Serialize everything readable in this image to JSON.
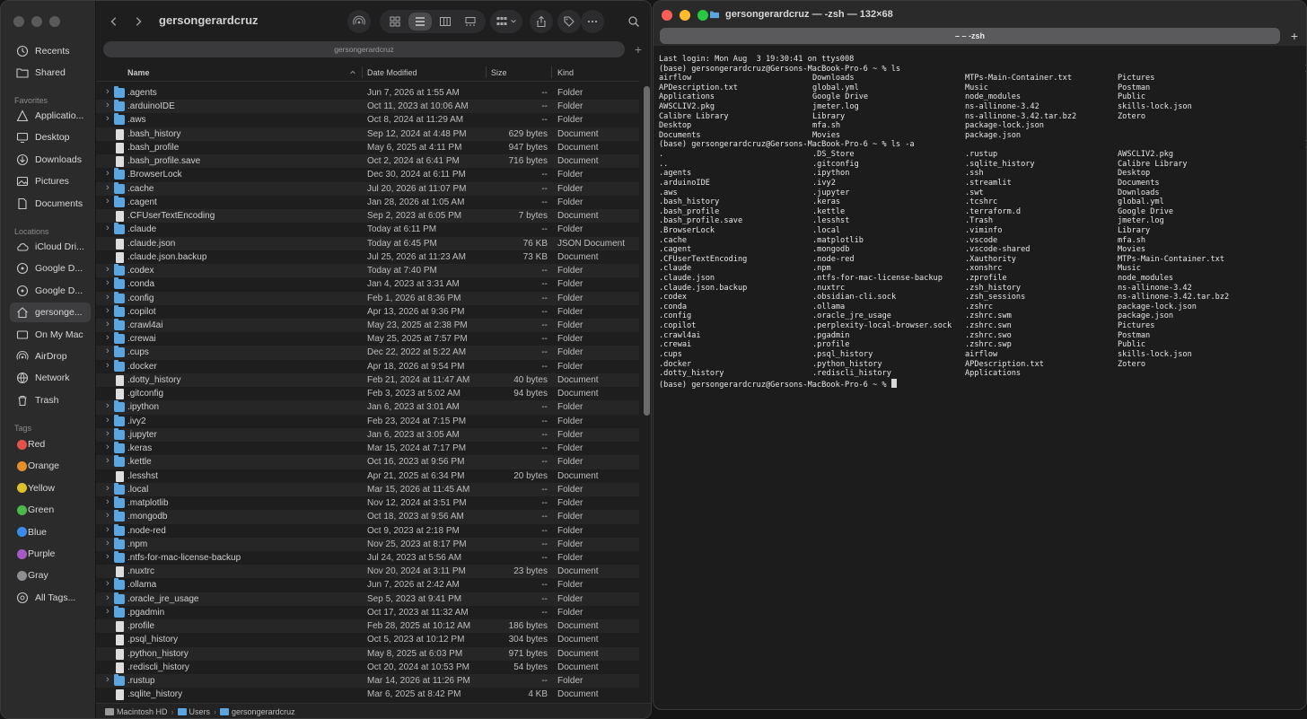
{
  "finder": {
    "title": "gersongerardcruz",
    "path_title": "gersongerardcruz",
    "sidebar": {
      "favorites_label": "Favorites",
      "locations_label": "Locations",
      "tags_label": "Tags",
      "top_items": [
        {
          "label": "Recents",
          "icon": "clock-icon"
        },
        {
          "label": "Shared",
          "icon": "shared-folder-icon"
        }
      ],
      "favorites": [
        {
          "label": "Applicatio...",
          "icon": "applications-icon"
        },
        {
          "label": "Desktop",
          "icon": "desktop-icon"
        },
        {
          "label": "Downloads",
          "icon": "downloads-icon"
        },
        {
          "label": "Pictures",
          "icon": "pictures-icon"
        },
        {
          "label": "Documents",
          "icon": "document-icon"
        }
      ],
      "locations": [
        {
          "label": "iCloud Dri...",
          "icon": "cloud-icon"
        },
        {
          "label": "Google D...",
          "icon": "drive-icon"
        },
        {
          "label": "Google D...",
          "icon": "drive-icon"
        },
        {
          "label": "gersonge...",
          "icon": "home-icon"
        },
        {
          "label": "On My Mac",
          "icon": "folder-icon"
        },
        {
          "label": "AirDrop",
          "icon": "airdrop-icon"
        },
        {
          "label": "Network",
          "icon": "network-icon"
        },
        {
          "label": "Trash",
          "icon": "trash-icon"
        }
      ],
      "tags": [
        {
          "label": "Red",
          "color": "#e0524a"
        },
        {
          "label": "Orange",
          "color": "#e58e2a"
        },
        {
          "label": "Yellow",
          "color": "#dcc12a"
        },
        {
          "label": "Green",
          "color": "#4cb84a"
        },
        {
          "label": "Blue",
          "color": "#3a8bea"
        },
        {
          "label": "Purple",
          "color": "#a65ac4"
        },
        {
          "label": "Gray",
          "color": "#8e8e92"
        },
        {
          "label": "All Tags...",
          "color": ""
        }
      ]
    },
    "columns": {
      "name": "Name",
      "date": "Date Modified",
      "size": "Size",
      "kind": "Kind"
    },
    "rows": [
      {
        "name": ".agents",
        "date": "Jun 7, 2026 at 1:55 AM",
        "size": "--",
        "kind": "Folder",
        "folder": true
      },
      {
        "name": ".arduinoIDE",
        "date": "Oct 11, 2023 at 10:06 AM",
        "size": "--",
        "kind": "Folder",
        "folder": true
      },
      {
        "name": ".aws",
        "date": "Oct 8, 2024 at 11:29 AM",
        "size": "--",
        "kind": "Folder",
        "folder": true
      },
      {
        "name": ".bash_history",
        "date": "Sep 12, 2024 at 4:48 PM",
        "size": "629 bytes",
        "kind": "Document",
        "folder": false
      },
      {
        "name": ".bash_profile",
        "date": "May 6, 2025 at 4:11 PM",
        "size": "947 bytes",
        "kind": "Document",
        "folder": false
      },
      {
        "name": ".bash_profile.save",
        "date": "Oct 2, 2024 at 6:41 PM",
        "size": "716 bytes",
        "kind": "Document",
        "folder": false
      },
      {
        "name": ".BrowserLock",
        "date": "Dec 30, 2024 at 6:11 PM",
        "size": "--",
        "kind": "Folder",
        "folder": true
      },
      {
        "name": ".cache",
        "date": "Jul 20, 2026 at 11:07 PM",
        "size": "--",
        "kind": "Folder",
        "folder": true
      },
      {
        "name": ".cagent",
        "date": "Jan 28, 2026 at 1:05 AM",
        "size": "--",
        "kind": "Folder",
        "folder": true
      },
      {
        "name": ".CFUserTextEncoding",
        "date": "Sep 2, 2023 at 6:05 PM",
        "size": "7 bytes",
        "kind": "Document",
        "folder": false
      },
      {
        "name": ".claude",
        "date": "Today at 6:11 PM",
        "size": "--",
        "kind": "Folder",
        "folder": true
      },
      {
        "name": ".claude.json",
        "date": "Today at 6:45 PM",
        "size": "76 KB",
        "kind": "JSON Document",
        "folder": false
      },
      {
        "name": ".claude.json.backup",
        "date": "Jul 25, 2026 at 11:23 AM",
        "size": "73 KB",
        "kind": "Document",
        "folder": false
      },
      {
        "name": ".codex",
        "date": "Today at 7:40 PM",
        "size": "--",
        "kind": "Folder",
        "folder": true
      },
      {
        "name": ".conda",
        "date": "Jan 4, 2023 at 3:31 AM",
        "size": "--",
        "kind": "Folder",
        "folder": true
      },
      {
        "name": ".config",
        "date": "Feb 1, 2026 at 8:36 PM",
        "size": "--",
        "kind": "Folder",
        "folder": true
      },
      {
        "name": ".copilot",
        "date": "Apr 13, 2026 at 9:36 PM",
        "size": "--",
        "kind": "Folder",
        "folder": true
      },
      {
        "name": ".crawl4ai",
        "date": "May 23, 2025 at 2:38 PM",
        "size": "--",
        "kind": "Folder",
        "folder": true
      },
      {
        "name": ".crewai",
        "date": "May 25, 2025 at 7:57 PM",
        "size": "--",
        "kind": "Folder",
        "folder": true
      },
      {
        "name": ".cups",
        "date": "Dec 22, 2022 at 5:22 AM",
        "size": "--",
        "kind": "Folder",
        "folder": true
      },
      {
        "name": ".docker",
        "date": "Apr 18, 2026 at 9:54 PM",
        "size": "--",
        "kind": "Folder",
        "folder": true
      },
      {
        "name": ".dotty_history",
        "date": "Feb 21, 2024 at 11:47 AM",
        "size": "40 bytes",
        "kind": "Document",
        "folder": false
      },
      {
        "name": ".gitconfig",
        "date": "Feb 3, 2023 at 5:02 AM",
        "size": "94 bytes",
        "kind": "Document",
        "folder": false
      },
      {
        "name": ".ipython",
        "date": "Jan 6, 2023 at 3:01 AM",
        "size": "--",
        "kind": "Folder",
        "folder": true
      },
      {
        "name": ".ivy2",
        "date": "Feb 23, 2024 at 7:15 PM",
        "size": "--",
        "kind": "Folder",
        "folder": true
      },
      {
        "name": ".jupyter",
        "date": "Jan 6, 2023 at 3:05 AM",
        "size": "--",
        "kind": "Folder",
        "folder": true
      },
      {
        "name": ".keras",
        "date": "Mar 15, 2024 at 7:17 PM",
        "size": "--",
        "kind": "Folder",
        "folder": true
      },
      {
        "name": ".kettle",
        "date": "Oct 16, 2023 at 9:56 PM",
        "size": "--",
        "kind": "Folder",
        "folder": true
      },
      {
        "name": ".lesshst",
        "date": "Apr 21, 2025 at 6:34 PM",
        "size": "20 bytes",
        "kind": "Document",
        "folder": false
      },
      {
        "name": ".local",
        "date": "Mar 15, 2026 at 11:45 AM",
        "size": "--",
        "kind": "Folder",
        "folder": true
      },
      {
        "name": ".matplotlib",
        "date": "Nov 12, 2024 at 3:51 PM",
        "size": "--",
        "kind": "Folder",
        "folder": true
      },
      {
        "name": ".mongodb",
        "date": "Oct 18, 2023 at 9:56 AM",
        "size": "--",
        "kind": "Folder",
        "folder": true
      },
      {
        "name": ".node-red",
        "date": "Oct 9, 2023 at 2:18 PM",
        "size": "--",
        "kind": "Folder",
        "folder": true
      },
      {
        "name": ".npm",
        "date": "Nov 25, 2023 at 8:17 PM",
        "size": "--",
        "kind": "Folder",
        "folder": true
      },
      {
        "name": ".ntfs-for-mac-license-backup",
        "date": "Jul 24, 2023 at 5:56 AM",
        "size": "--",
        "kind": "Folder",
        "folder": true
      },
      {
        "name": ".nuxtrc",
        "date": "Nov 20, 2024 at 3:11 PM",
        "size": "23 bytes",
        "kind": "Document",
        "folder": false
      },
      {
        "name": ".ollama",
        "date": "Jun 7, 2026 at 2:42 AM",
        "size": "--",
        "kind": "Folder",
        "folder": true
      },
      {
        "name": ".oracle_jre_usage",
        "date": "Sep 5, 2023 at 9:41 PM",
        "size": "--",
        "kind": "Folder",
        "folder": true
      },
      {
        "name": ".pgadmin",
        "date": "Oct 17, 2023 at 11:32 AM",
        "size": "--",
        "kind": "Folder",
        "folder": true
      },
      {
        "name": ".profile",
        "date": "Feb 28, 2025 at 10:12 AM",
        "size": "186 bytes",
        "kind": "Document",
        "folder": false
      },
      {
        "name": ".psql_history",
        "date": "Oct 5, 2023 at 10:12 PM",
        "size": "304 bytes",
        "kind": "Document",
        "folder": false
      },
      {
        "name": ".python_history",
        "date": "May 8, 2025 at 6:03 PM",
        "size": "971 bytes",
        "kind": "Document",
        "folder": false
      },
      {
        "name": ".rediscli_history",
        "date": "Oct 20, 2024 at 10:53 PM",
        "size": "54 bytes",
        "kind": "Document",
        "folder": false
      },
      {
        "name": ".rustup",
        "date": "Mar 14, 2026 at 11:26 PM",
        "size": "--",
        "kind": "Folder",
        "folder": true
      },
      {
        "name": ".sqlite_history",
        "date": "Mar 6, 2025 at 8:42 PM",
        "size": "4 KB",
        "kind": "Document",
        "folder": false
      }
    ],
    "statusbar": [
      "Macintosh HD",
      "Users",
      "gersongerardcruz"
    ]
  },
  "terminal": {
    "title": "gersongerardcruz — -zsh — 132×68",
    "tab_label": "– – -zsh",
    "lines": [
      {
        "text": "Last login: Mon Aug  3 19:30:41 on ttys008"
      },
      {
        "text": "(base) gersongerardcruz@Gersons-MacBook-Pro-6 ~ % ls",
        "mark": true
      },
      {
        "cols": [
          "airflow",
          "Downloads",
          "MTPs-Main-Container.txt",
          "Pictures"
        ]
      },
      {
        "cols": [
          "APDescription.txt",
          "global.yml",
          "Music",
          "Postman"
        ]
      },
      {
        "cols": [
          "Applications",
          "Google Drive",
          "node_modules",
          "Public"
        ]
      },
      {
        "cols": [
          "AWSCLIV2.pkg",
          "jmeter.log",
          "ns-allinone-3.42",
          "skills-lock.json"
        ]
      },
      {
        "cols": [
          "Calibre Library",
          "Library",
          "ns-allinone-3.42.tar.bz2",
          "Zotero"
        ]
      },
      {
        "cols": [
          "Desktop",
          "mfa.sh",
          "package-lock.json",
          ""
        ]
      },
      {
        "cols": [
          "Documents",
          "Movies",
          "package.json",
          ""
        ]
      },
      {
        "text": "(base) gersongerardcruz@Gersons-MacBook-Pro-6 ~ % ls -a",
        "mark": true
      },
      {
        "cols": [
          ".",
          ".DS_Store",
          ".rustup",
          "AWSCLIV2.pkg"
        ]
      },
      {
        "cols": [
          "..",
          ".gitconfig",
          ".sqlite_history",
          "Calibre Library"
        ]
      },
      {
        "cols": [
          ".agents",
          ".ipython",
          ".ssh",
          "Desktop"
        ]
      },
      {
        "cols": [
          ".arduinoIDE",
          ".ivy2",
          ".streamlit",
          "Documents"
        ]
      },
      {
        "cols": [
          ".aws",
          ".jupyter",
          ".swt",
          "Downloads"
        ]
      },
      {
        "cols": [
          ".bash_history",
          ".keras",
          ".tcshrc",
          "global.yml"
        ]
      },
      {
        "cols": [
          ".bash_profile",
          ".kettle",
          ".terraform.d",
          "Google Drive"
        ]
      },
      {
        "cols": [
          ".bash_profile.save",
          ".lesshst",
          ".Trash",
          "jmeter.log"
        ]
      },
      {
        "cols": [
          ".BrowserLock",
          ".local",
          ".viminfo",
          "Library"
        ]
      },
      {
        "cols": [
          ".cache",
          ".matplotlib",
          ".vscode",
          "mfa.sh"
        ]
      },
      {
        "cols": [
          ".cagent",
          ".mongodb",
          ".vscode-shared",
          "Movies"
        ]
      },
      {
        "cols": [
          ".CFUserTextEncoding",
          ".node-red",
          ".Xauthority",
          "MTPs-Main-Container.txt"
        ]
      },
      {
        "cols": [
          ".claude",
          ".npm",
          ".xonshrc",
          "Music"
        ]
      },
      {
        "cols": [
          ".claude.json",
          ".ntfs-for-mac-license-backup",
          ".zprofile",
          "node_modules"
        ]
      },
      {
        "cols": [
          ".claude.json.backup",
          ".nuxtrc",
          ".zsh_history",
          "ns-allinone-3.42"
        ]
      },
      {
        "cols": [
          ".codex",
          ".obsidian-cli.sock",
          ".zsh_sessions",
          "ns-allinone-3.42.tar.bz2"
        ]
      },
      {
        "cols": [
          ".conda",
          ".ollama",
          ".zshrc",
          "package-lock.json"
        ]
      },
      {
        "cols": [
          ".config",
          ".oracle_jre_usage",
          ".zshrc.swm",
          "package.json"
        ]
      },
      {
        "cols": [
          ".copilot",
          ".perplexity-local-browser.sock",
          ".zshrc.swn",
          "Pictures"
        ]
      },
      {
        "cols": [
          ".crawl4ai",
          ".pgadmin",
          ".zshrc.swo",
          "Postman"
        ]
      },
      {
        "cols": [
          ".crewai",
          ".profile",
          ".zshrc.swp",
          "Public"
        ]
      },
      {
        "cols": [
          ".cups",
          ".psql_history",
          "airflow",
          "skills-lock.json"
        ]
      },
      {
        "cols": [
          ".docker",
          ".python_history",
          "APDescription.txt",
          "Zotero"
        ]
      },
      {
        "cols": [
          ".dotty_history",
          ".rediscli_history",
          "Applications",
          ""
        ]
      },
      {
        "text": "(base) gersongerardcruz@Gersons-MacBook-Pro-6 ~ % ",
        "cursor": true
      }
    ]
  }
}
